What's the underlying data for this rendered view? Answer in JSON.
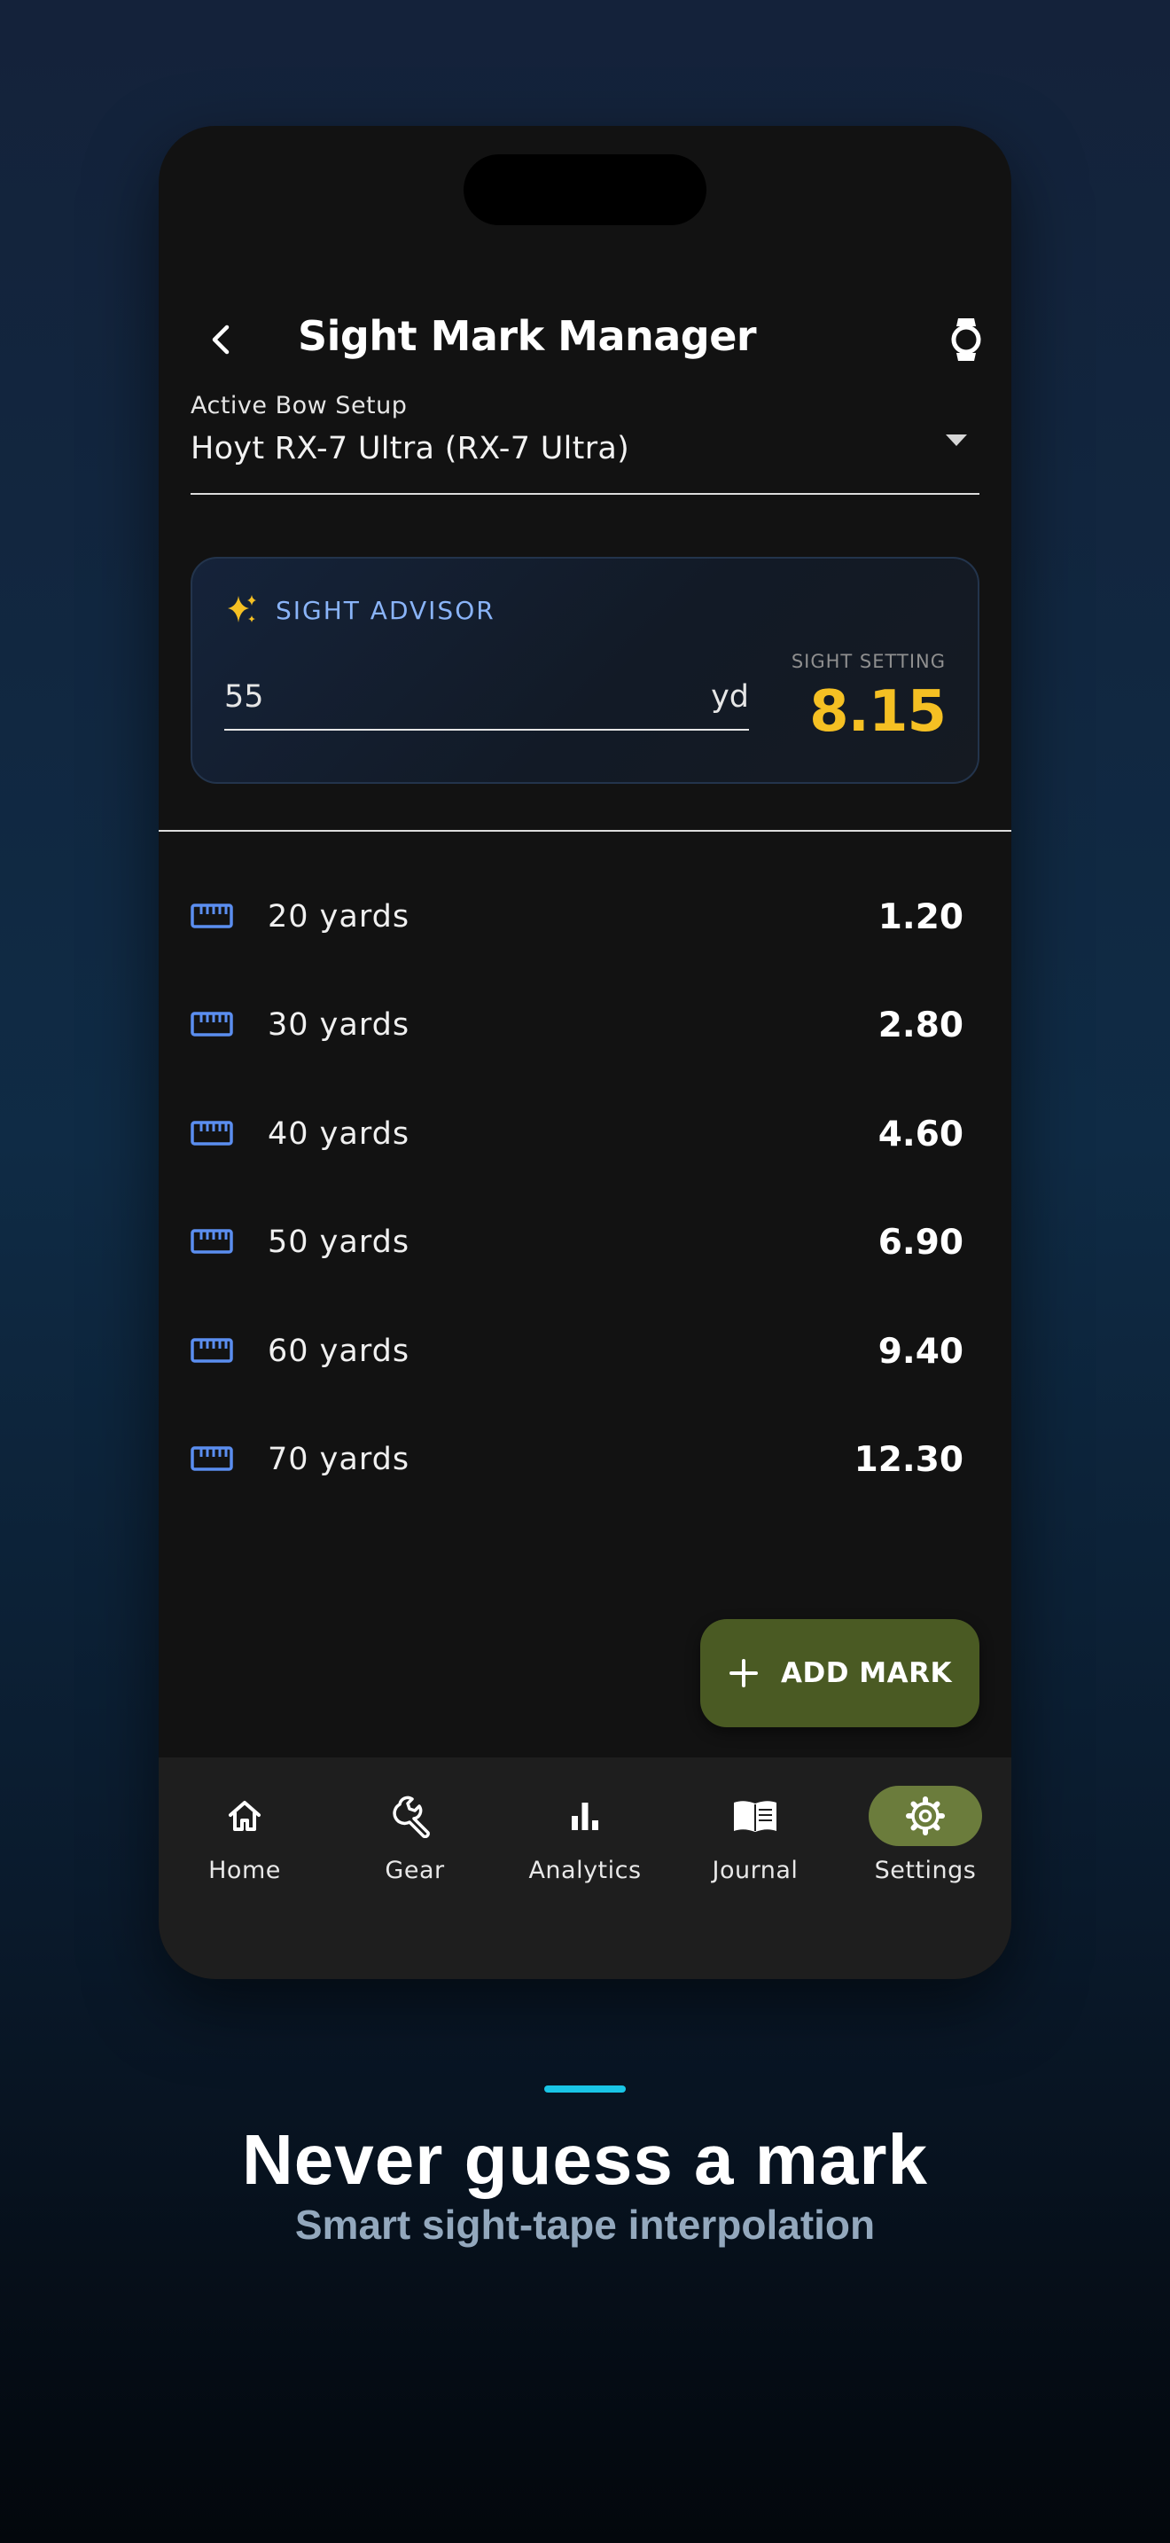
{
  "appbar": {
    "title": "Sight Mark Manager"
  },
  "bow_setup": {
    "label": "Active Bow Setup",
    "value": "Hoyt RX-7 Ultra (RX-7 Ultra)"
  },
  "advisor": {
    "title": "SIGHT ADVISOR",
    "distance_value": "55",
    "unit": "yd",
    "setting_label": "SIGHT SETTING",
    "setting_value": "8.15"
  },
  "marks": [
    {
      "distance": "20 yards",
      "value": "1.20"
    },
    {
      "distance": "30 yards",
      "value": "2.80"
    },
    {
      "distance": "40 yards",
      "value": "4.60"
    },
    {
      "distance": "50 yards",
      "value": "6.90"
    },
    {
      "distance": "60 yards",
      "value": "9.40"
    },
    {
      "distance": "70 yards",
      "value": "12.30"
    }
  ],
  "fab": {
    "label": "ADD MARK",
    "icon": "plus-icon"
  },
  "nav": [
    {
      "label": "Home",
      "icon": "home-icon",
      "active": false
    },
    {
      "label": "Gear",
      "icon": "wrench-icon",
      "active": false
    },
    {
      "label": "Analytics",
      "icon": "bar-chart-icon",
      "active": false
    },
    {
      "label": "Journal",
      "icon": "book-icon",
      "active": false
    },
    {
      "label": "Settings",
      "icon": "gear-icon",
      "active": true
    }
  ],
  "promo": {
    "headline": "Never guess a mark",
    "subheadline": "Smart sight-tape interpolation"
  },
  "colors": {
    "accent_gold": "#f5c023",
    "advisor_blue": "#8ab4f8",
    "fab_green": "#4a5a23",
    "nav_active": "#6b7c3c",
    "accent_cyan": "#19c5e6"
  }
}
